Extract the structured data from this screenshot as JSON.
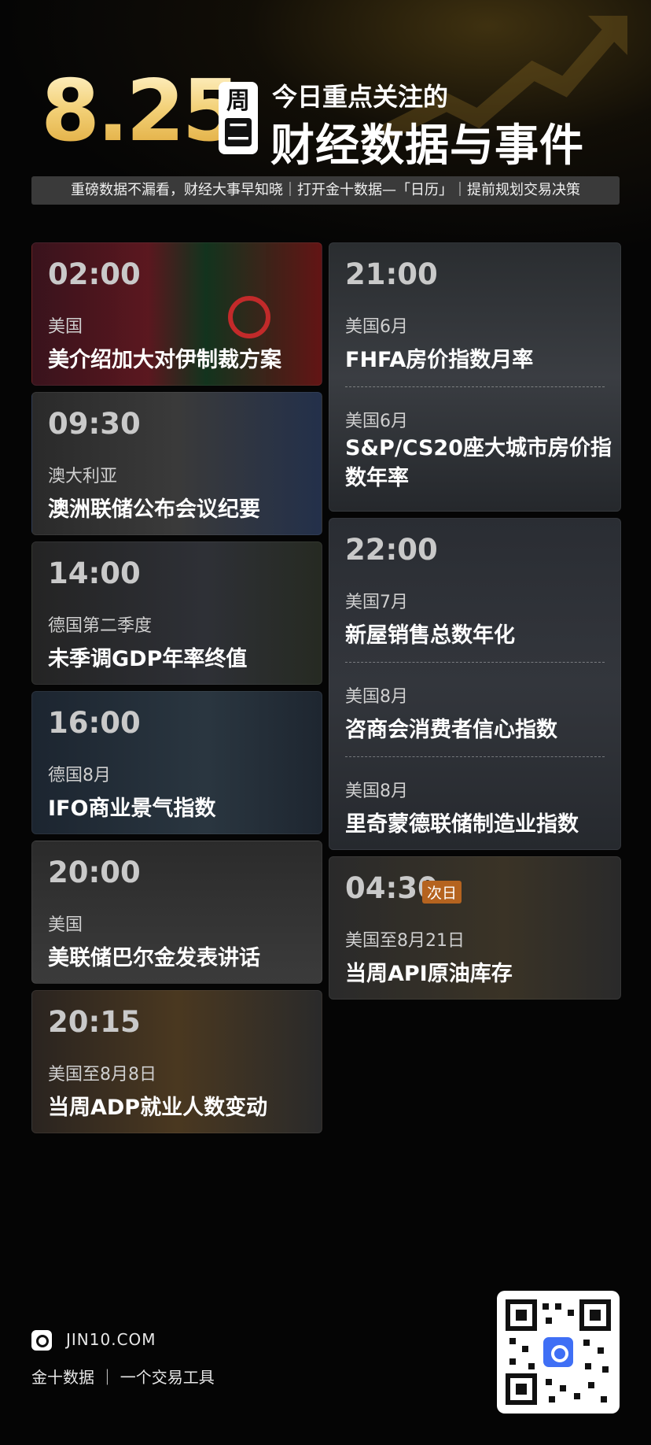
{
  "header": {
    "date": "8.25",
    "weekday_1": "周",
    "weekday_2": "二",
    "subtitle": "今日重点关注的",
    "title": "财经数据与事件",
    "banner": "重磅数据不漏看，财经大事早知晓｜打开金十数据—「日历」｜提前规划交易决策"
  },
  "left_cards": [
    {
      "time": "02:00",
      "region": "美国",
      "title": "美介绍加大对伊制裁方案"
    },
    {
      "time": "09:30",
      "region": "澳大利亚",
      "title": "澳洲联储公布会议纪要"
    },
    {
      "time": "14:00",
      "region": "德国第二季度",
      "title": "未季调GDP年率终值"
    },
    {
      "time": "16:00",
      "region": "德国8月",
      "title": "IFO商业景气指数"
    },
    {
      "time": "20:00",
      "region": "美国",
      "title": "美联储巴尔金发表讲话"
    },
    {
      "time": "20:15",
      "region": "美国至8月8日",
      "title": "当周ADP就业人数变动"
    }
  ],
  "right_cards": [
    {
      "time": "21:00",
      "items": [
        {
          "region": "美国6月",
          "title": "FHFA房价指数月率"
        },
        {
          "region": "美国6月",
          "title": "S&P/CS20座大城市房价指数年率"
        }
      ]
    },
    {
      "time": "22:00",
      "items": [
        {
          "region": "美国7月",
          "title": "新屋销售总数年化"
        },
        {
          "region": "美国8月",
          "title": "咨商会消费者信心指数"
        },
        {
          "region": "美国8月",
          "title": "里奇蒙德联储制造业指数"
        }
      ]
    },
    {
      "time": "04:30",
      "badge": "次日",
      "items": [
        {
          "region": "美国至8月21日",
          "title": "当周API原油库存"
        }
      ]
    }
  ],
  "footer": {
    "site": "JIN10.COM",
    "tagline": "金十数据 ｜ 一个交易工具",
    "logo_icon": "jin10-logo-icon",
    "qr_icon": "qr-code-icon"
  },
  "colors": {
    "accent_gold": "#e0a93a",
    "badge_orange": "#b5631f",
    "background": "#050505"
  }
}
